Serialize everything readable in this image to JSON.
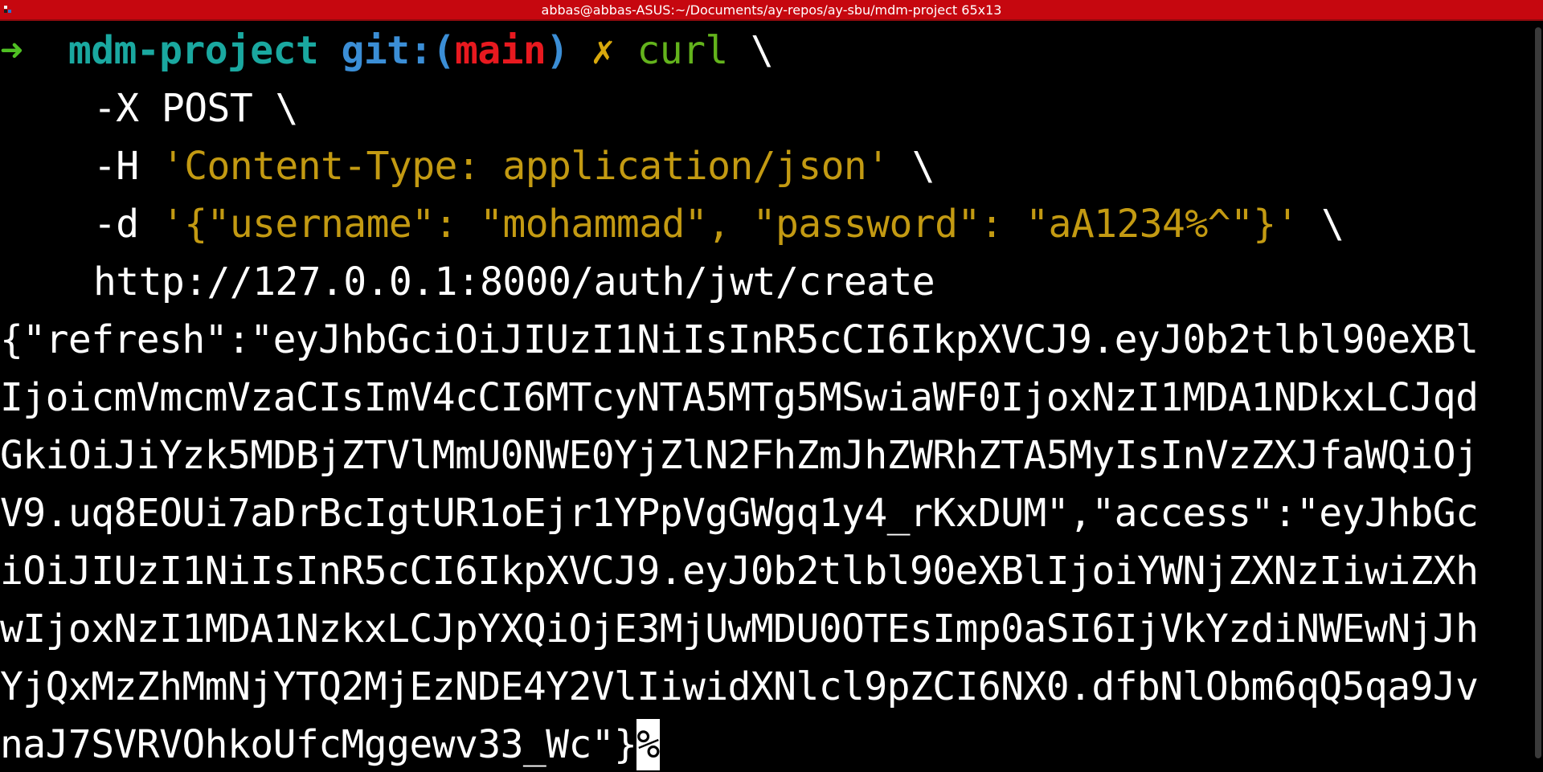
{
  "window": {
    "title": "abbas@abbas-ASUS:~/Documents/ay-repos/ay-sbu/mdm-project 65x13"
  },
  "prompt": {
    "arrow": "➜",
    "dir": "mdm-project",
    "git_open": "git:(",
    "branch": "main",
    "git_close": ")",
    "dirty": "✗",
    "command": "curl",
    "continuation": "\\"
  },
  "command_lines": [
    {
      "flag": "-X",
      "arg": "POST",
      "cont": "\\"
    },
    {
      "flag": "-H",
      "arg": "'Content-Type: application/json'",
      "cont": "\\"
    },
    {
      "flag": "-d",
      "arg": "'{\"username\": \"mohammad\", \"password\": \"aA1234%^\"}'",
      "cont": "\\"
    },
    {
      "url": "http://127.0.0.1:8000/auth/jwt/create"
    }
  ],
  "output_lines": [
    "{\"refresh\":\"eyJhbGciOiJIUzI1NiIsInR5cCI6IkpXVCJ9.eyJ0b2tlbl90eXBl",
    "IjoicmVmcmVzaCIsImV4cCI6MTcyNTA5MTg5MSwiaWF0IjoxNzI1MDA1NDkxLCJqd",
    "GkiOiJiYzk5MDBjZTVlMmU0NWE0YjZlN2FhZmJhZWRhZTA5MyIsInVzZXJfaWQiOj",
    "V9.uq8EOUi7aDrBcIgtUR1oEjr1YPpVgGWgq1y4_rKxDUM\",\"access\":\"eyJhbGc",
    "iOiJIUzI1NiIsInR5cCI6IkpXVCJ9.eyJ0b2tlbl90eXBlIjoiYWNjZXNzIiwiZXh",
    "wIjoxNzI1MDA1NzkxLCJpYXQiOjE3MjUwMDU0OTEsImp0aSI6IjVkYzdiNWEwNjJh",
    "YjQxMzZhMmNjYTQ2MjEzNDE4Y2VlIiwidXNlcl9pZCI6NX0.dfbNlObm6qQ5qa9Jv",
    "naJ7SVRVOhkoUfcMggewv33_Wc\"}"
  ],
  "cursor_char": "%"
}
